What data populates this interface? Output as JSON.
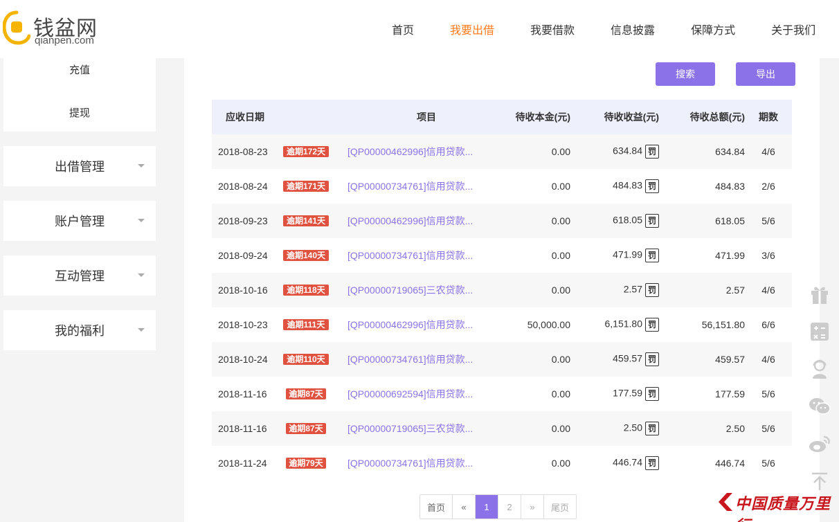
{
  "brand": {
    "name_cn": "钱盆网",
    "domain": "qianpen.com",
    "color": "#f5b400"
  },
  "nav": [
    {
      "label": "首页",
      "active": false
    },
    {
      "label": "我要出借",
      "active": true
    },
    {
      "label": "我要借款",
      "active": false
    },
    {
      "label": "信息披露",
      "active": false
    },
    {
      "label": "保障方式",
      "active": false
    },
    {
      "label": "关于我们",
      "active": false
    }
  ],
  "sidebar": {
    "sub_items": [
      "充值",
      "提现"
    ],
    "menus": [
      "出借管理",
      "账户管理",
      "互动管理",
      "我的福利"
    ]
  },
  "toolbar": {
    "search_label": "搜索",
    "export_label": "导出",
    "accent": "#8b72e8"
  },
  "table": {
    "headers": [
      "应收日期",
      "项目",
      "待收本金(元)",
      "待收收益(元)",
      "待收总额(元)",
      "期数"
    ],
    "fine_mark": "罚",
    "rows": [
      {
        "date": "2018-08-23",
        "overdue": "逾期172天",
        "project": "[QP00000462996]信用贷款...",
        "principal": "0.00",
        "interest": "634.84",
        "total": "634.84",
        "period": "4/6"
      },
      {
        "date": "2018-08-24",
        "overdue": "逾期171天",
        "project": "[QP00000734761]信用贷款...",
        "principal": "0.00",
        "interest": "484.83",
        "total": "484.83",
        "period": "2/6"
      },
      {
        "date": "2018-09-23",
        "overdue": "逾期141天",
        "project": "[QP00000462996]信用贷款...",
        "principal": "0.00",
        "interest": "618.05",
        "total": "618.05",
        "period": "5/6"
      },
      {
        "date": "2018-09-24",
        "overdue": "逾期140天",
        "project": "[QP00000734761]信用贷款...",
        "principal": "0.00",
        "interest": "471.99",
        "total": "471.99",
        "period": "3/6"
      },
      {
        "date": "2018-10-16",
        "overdue": "逾期118天",
        "project": "[QP00000719065]三农贷款...",
        "principal": "0.00",
        "interest": "2.57",
        "total": "2.57",
        "period": "4/6"
      },
      {
        "date": "2018-10-23",
        "overdue": "逾期111天",
        "project": "[QP00000462996]信用贷款...",
        "principal": "50,000.00",
        "interest": "6,151.80",
        "total": "56,151.80",
        "period": "6/6"
      },
      {
        "date": "2018-10-24",
        "overdue": "逾期110天",
        "project": "[QP00000734761]信用贷款...",
        "principal": "0.00",
        "interest": "459.57",
        "total": "459.57",
        "period": "4/6"
      },
      {
        "date": "2018-11-16",
        "overdue": "逾期87天",
        "project": "[QP00000692594]信用贷款...",
        "principal": "0.00",
        "interest": "177.59",
        "total": "177.59",
        "period": "5/6"
      },
      {
        "date": "2018-11-16",
        "overdue": "逾期87天",
        "project": "[QP00000719065]三农贷款...",
        "principal": "0.00",
        "interest": "2.50",
        "total": "2.50",
        "period": "5/6"
      },
      {
        "date": "2018-11-24",
        "overdue": "逾期79天",
        "project": "[QP00000734761]信用贷款...",
        "principal": "0.00",
        "interest": "446.74",
        "total": "446.74",
        "period": "5/6"
      }
    ]
  },
  "pagination": {
    "first": "首页",
    "prev": "«",
    "pages": [
      "1",
      "2"
    ],
    "current": "1",
    "next": "»",
    "last": "尾页"
  },
  "float_icons": [
    "gift-icon",
    "calculator-icon",
    "customer-service-icon",
    "wechat-icon",
    "weibo-icon",
    "back-to-top-icon"
  ],
  "watermark": {
    "text": "中国质量万里行",
    "color": "#c8161d"
  }
}
